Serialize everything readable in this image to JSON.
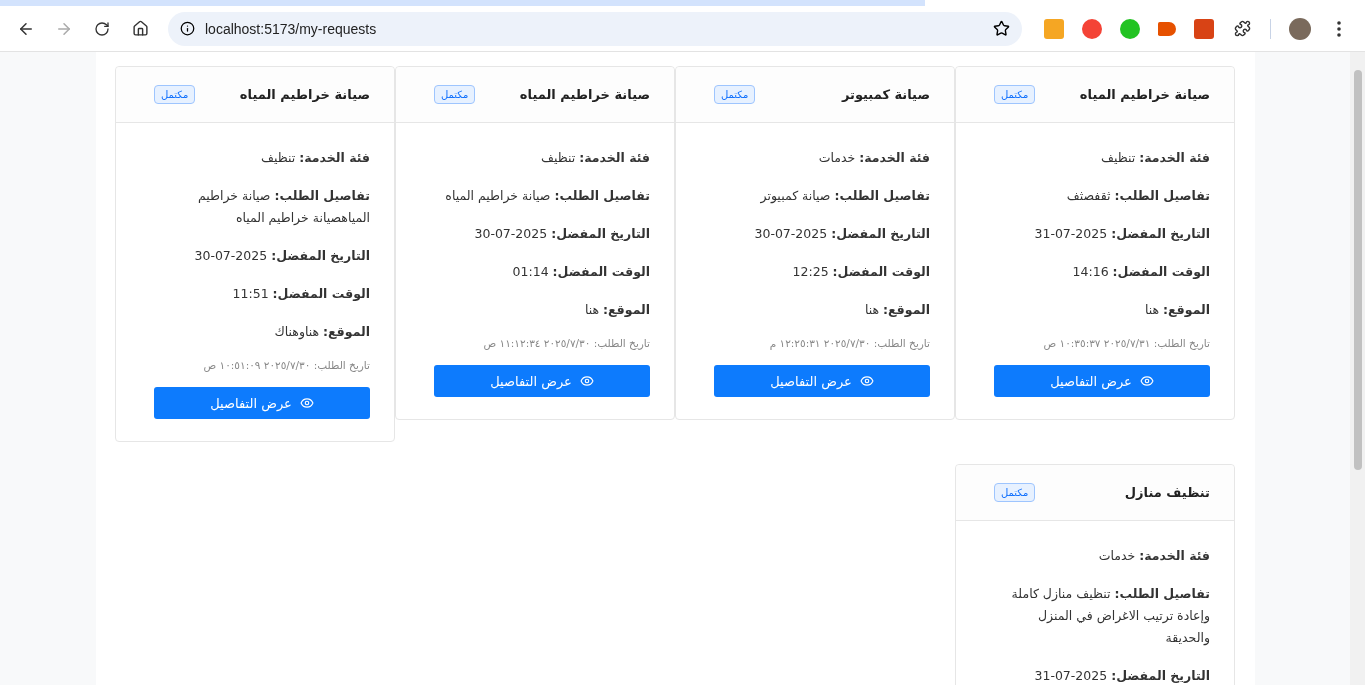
{
  "browser": {
    "url": "localhost:5173/my-requests"
  },
  "requests": [
    {
      "title": "صيانة خراطيم المياه",
      "status": "مكتمل",
      "fields": [
        "**فئة الخدمة:** تنظيف",
        "**تفاصيل الطلب:** ثقفصثف",
        "**التاريخ المفضل:** 2025-07-31",
        "**الوقت المفضل:** 14:16",
        "**الموقع:** هنا"
      ],
      "request_date": "تاريخ الطلب: ٢٠٢٥/٧/٣١ ١٠:٣٥:٣٧ ص",
      "button": "عرض التفاصيل"
    },
    {
      "title": "صيانة كمبيوتر",
      "status": "مكتمل",
      "fields": [
        "**فئة الخدمة:** خدمات",
        "**تفاصيل الطلب:** صيانة كمبيوتر",
        "**التاريخ المفضل:** 2025-07-30",
        "**الوقت المفضل:** 12:25",
        "**الموقع:** هنا"
      ],
      "request_date": "تاريخ الطلب: ٢٠٢٥/٧/٣٠ ١٢:٢٥:٣١ م",
      "button": "عرض التفاصيل"
    },
    {
      "title": "صيانة خراطيم المياه",
      "status": "مكتمل",
      "fields": [
        "**فئة الخدمة:** تنظيف",
        "**تفاصيل الطلب:** صيانة خراطيم المياه",
        "**التاريخ المفضل:** 2025-07-30",
        "**الوقت المفضل:** 01:14",
        "**الموقع:** هنا"
      ],
      "request_date": "تاريخ الطلب: ٢٠٢٥/٧/٣٠ ١١:١٢:٣٤ ص",
      "button": "عرض التفاصيل"
    },
    {
      "title": "صيانة خراطيم المياه",
      "status": "مكتمل",
      "fields": [
        "**فئة الخدمة:** تنظيف",
        "**تفاصيل الطلب:** صيانة خراطيم المياهصيانة خراطيم المياه",
        "**التاريخ المفضل:** 2025-07-30",
        "**الوقت المفضل:** 11:51",
        "**الموقع:** هناوهناك"
      ],
      "request_date": "تاريخ الطلب: ٢٠٢٥/٧/٣٠ ١٠:٥١:٠٩ ص",
      "button": "عرض التفاصيل"
    },
    {
      "title": "تنظيف منازل",
      "status": "مكتمل",
      "fields": [
        "**فئة الخدمة:** خدمات",
        "**تفاصيل الطلب:** تنظيف منازل كاملة وإعادة ترتيب الاغراض في المنزل والحديقة",
        "**التاريخ المفضل:** 2025-07-31"
      ]
    }
  ]
}
